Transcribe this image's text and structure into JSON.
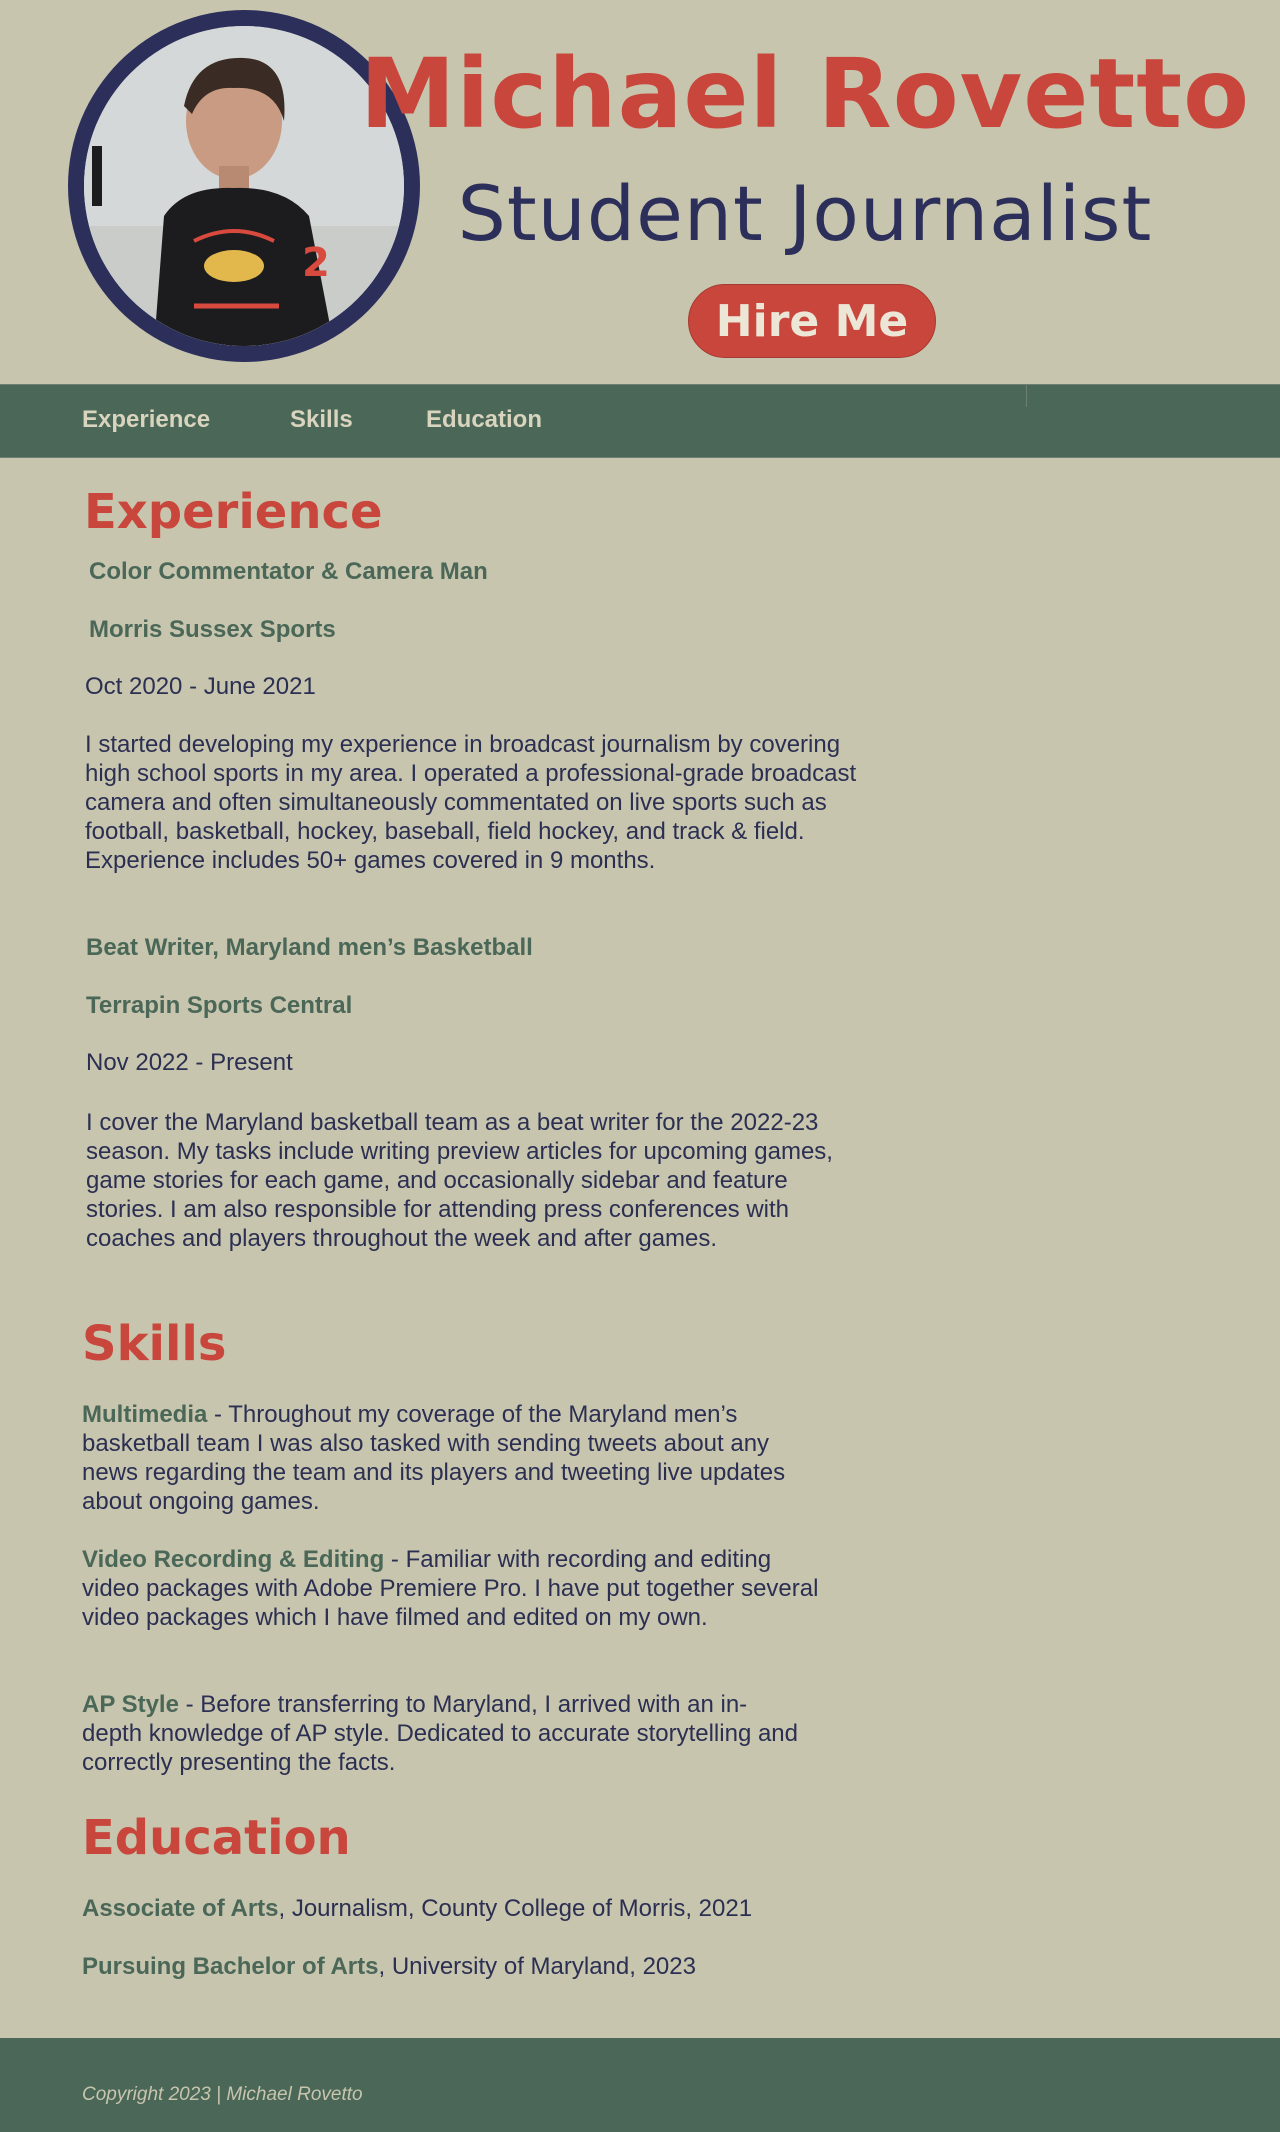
{
  "header": {
    "name": "Michael Rovetto",
    "title": "Student Journalist",
    "hire_label": "Hire Me"
  },
  "nav": {
    "items": [
      "Experience",
      "Skills",
      "Education"
    ]
  },
  "experience": {
    "heading": "Experience",
    "jobs": [
      {
        "role": "Color Commentator & Camera Man",
        "org": "Morris Sussex Sports",
        "dates": "Oct 2020 - June 2021",
        "description": "I started developing my experience in broadcast journalism by covering high school sports in my area. I operated a professional-grade broadcast camera and often simultaneously commentated on live sports such as football, basketball, hockey, baseball, field hockey, and track & field. Experience includes 50+ games covered in 9 months."
      },
      {
        "role": "Beat Writer, Maryland men’s Basketball",
        "org": "Terrapin Sports Central",
        "dates": "Nov 2022 - Present",
        "description": "I cover the Maryland basketball team as a beat writer for the 2022-23 season. My tasks include writing preview articles for upcoming games, game stories for each game, and occasionally sidebar and feature stories. I am also responsible for attending press conferences with coaches and players throughout the week and after games."
      }
    ]
  },
  "skills": {
    "heading": "Skills",
    "items": [
      {
        "name": "Multimedia",
        "text": " - Throughout my coverage of the Maryland men’s basketball team I was also tasked with sending tweets about any news regarding the team and its players and tweeting live updates about ongoing games."
      },
      {
        "name": "Video Recording & Editing",
        "text": " - Familiar with recording and editing video packages with Adobe Premiere Pro. I have put together several video packages which I have filmed and edited on my own."
      },
      {
        "name": "AP Style",
        "text": " - Before transferring to Maryland, I arrived with an in-depth knowledge of AP style. Dedicated to accurate storytelling and correctly presenting the facts."
      }
    ]
  },
  "education": {
    "heading": "Education",
    "items": [
      {
        "degree": "Associate of Arts",
        "detail": ", Journalism, County College of Morris, 2021"
      },
      {
        "degree": "Pursuing Bachelor of Arts",
        "detail": ", University of Maryland, 2023"
      }
    ]
  },
  "footer": {
    "copyright": "Copyright 2023 | Michael Rovetto"
  },
  "colors": {
    "background": "#c8c5ae",
    "accent_red": "#c8463c",
    "navy": "#2b2f5a",
    "green": "#4a6757"
  }
}
